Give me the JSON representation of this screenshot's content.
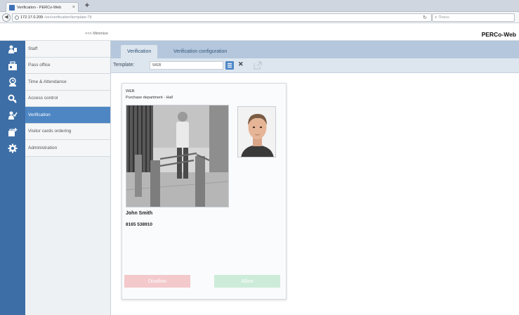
{
  "browser": {
    "tab_title": "Verification - PERCo-Web",
    "tab_close": "×",
    "new_tab": "+",
    "url_host": "172.17.0.209",
    "url_path": "/ver/verification/template:78",
    "search_placeholder": "Поиск"
  },
  "app": {
    "minimize_label": "<<< Minimize",
    "brand": "PERCo-Web"
  },
  "sidebar": {
    "items": [
      {
        "label": "Staff",
        "icon": "staff-icon"
      },
      {
        "label": "Pass office",
        "icon": "pass-office-icon"
      },
      {
        "label": "Time & Attendance",
        "icon": "time-attendance-icon"
      },
      {
        "label": "Access control",
        "icon": "key-icon"
      },
      {
        "label": "Verification",
        "icon": "verification-icon"
      },
      {
        "label": "Visitor cards ordering",
        "icon": "visitor-cards-icon"
      },
      {
        "label": "Administration",
        "icon": "gear-icon"
      }
    ],
    "active_index": 4
  },
  "main": {
    "tabs": [
      {
        "label": "Verification"
      },
      {
        "label": "Verification configuration"
      }
    ],
    "template_label": "Template:",
    "template_value": "WEB"
  },
  "card": {
    "title": "WEB",
    "location": "Purchase department - Hall",
    "person_name": "John Smith",
    "card_number": "8165 538910",
    "disallow_label": "Disallow",
    "allow_label": "Allow"
  },
  "colors": {
    "accent": "#4e86c4",
    "rail": "#3d6ea6",
    "disallow": "#f3c9cc",
    "allow": "#cdebd9"
  }
}
